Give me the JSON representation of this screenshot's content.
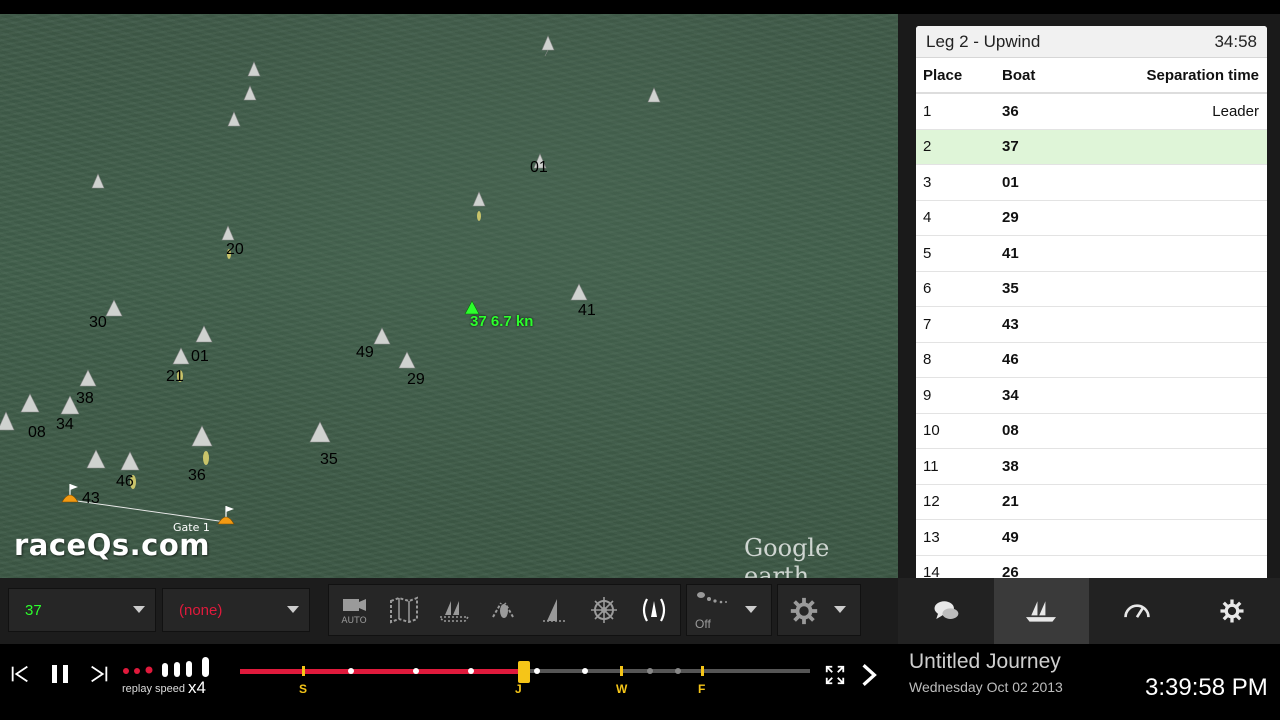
{
  "map": {
    "focus_label": "37 6.7 kn",
    "gate_label": "Gate 1",
    "brand": "raceQs.com",
    "provider": "Google earth",
    "boat_labels": [
      "01",
      "20",
      "30",
      "49",
      "29",
      "41",
      "01",
      "21",
      "38",
      "08",
      "34",
      "36",
      "35",
      "43",
      "46"
    ]
  },
  "leaderboard": {
    "leg_title": "Leg 2 - Upwind",
    "elapsed": "34:58",
    "columns": {
      "place": "Place",
      "boat": "Boat",
      "separation": "Separation time"
    },
    "rows": [
      {
        "place": "1",
        "boat": "36",
        "sep": "Leader"
      },
      {
        "place": "2",
        "boat": "37",
        "sep": ""
      },
      {
        "place": "3",
        "boat": "01",
        "sep": ""
      },
      {
        "place": "4",
        "boat": "29",
        "sep": ""
      },
      {
        "place": "5",
        "boat": "41",
        "sep": ""
      },
      {
        "place": "6",
        "boat": "35",
        "sep": ""
      },
      {
        "place": "7",
        "boat": "43",
        "sep": ""
      },
      {
        "place": "8",
        "boat": "46",
        "sep": ""
      },
      {
        "place": "9",
        "boat": "34",
        "sep": ""
      },
      {
        "place": "10",
        "boat": "08",
        "sep": ""
      },
      {
        "place": "11",
        "boat": "38",
        "sep": ""
      },
      {
        "place": "12",
        "boat": "21",
        "sep": ""
      },
      {
        "place": "13",
        "boat": "49",
        "sep": ""
      },
      {
        "place": "14",
        "boat": "26",
        "sep": ""
      }
    ]
  },
  "controls": {
    "primary_boat": "37",
    "compare_boat": "(none)",
    "camera_label": "AUTO",
    "trail_label": "Off"
  },
  "playback": {
    "replay_speed_label": "replay speed",
    "speed_multiplier": "x4",
    "markers": [
      "S",
      "J",
      "W",
      "F"
    ]
  },
  "journey": {
    "title": "Untitled Journey",
    "date": "Wednesday Oct 02 2013",
    "clock": "3:39:58 PM"
  },
  "colors": {
    "accent_green": "#2cff2c",
    "track_red": "#e01a3c",
    "marker_yellow": "#f5c518",
    "selected_row": "#dff5d8",
    "compare_red": "#e01a3c"
  }
}
